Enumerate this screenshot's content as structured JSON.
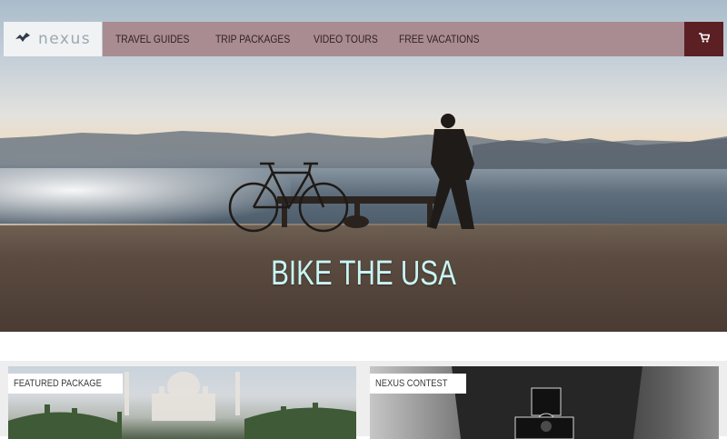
{
  "brand": {
    "logo_text": "nexus",
    "logo_icon": "bird-icon"
  },
  "nav": {
    "items": [
      {
        "label": "TRAVEL GUIDES"
      },
      {
        "label": "TRIP PACKAGES"
      },
      {
        "label": "VIDEO TOURS"
      },
      {
        "label": "FREE VACATIONS"
      }
    ],
    "cart_icon": "cart-icon"
  },
  "hero": {
    "title": "BIKE THE USA"
  },
  "cards": [
    {
      "label": "FEATURED PACKAGE"
    },
    {
      "label": "NEXUS CONTEST"
    }
  ],
  "colors": {
    "nav_bg": "#a88c91",
    "cart_bg": "#5c1f24",
    "hero_title": "#c8f5f4"
  }
}
